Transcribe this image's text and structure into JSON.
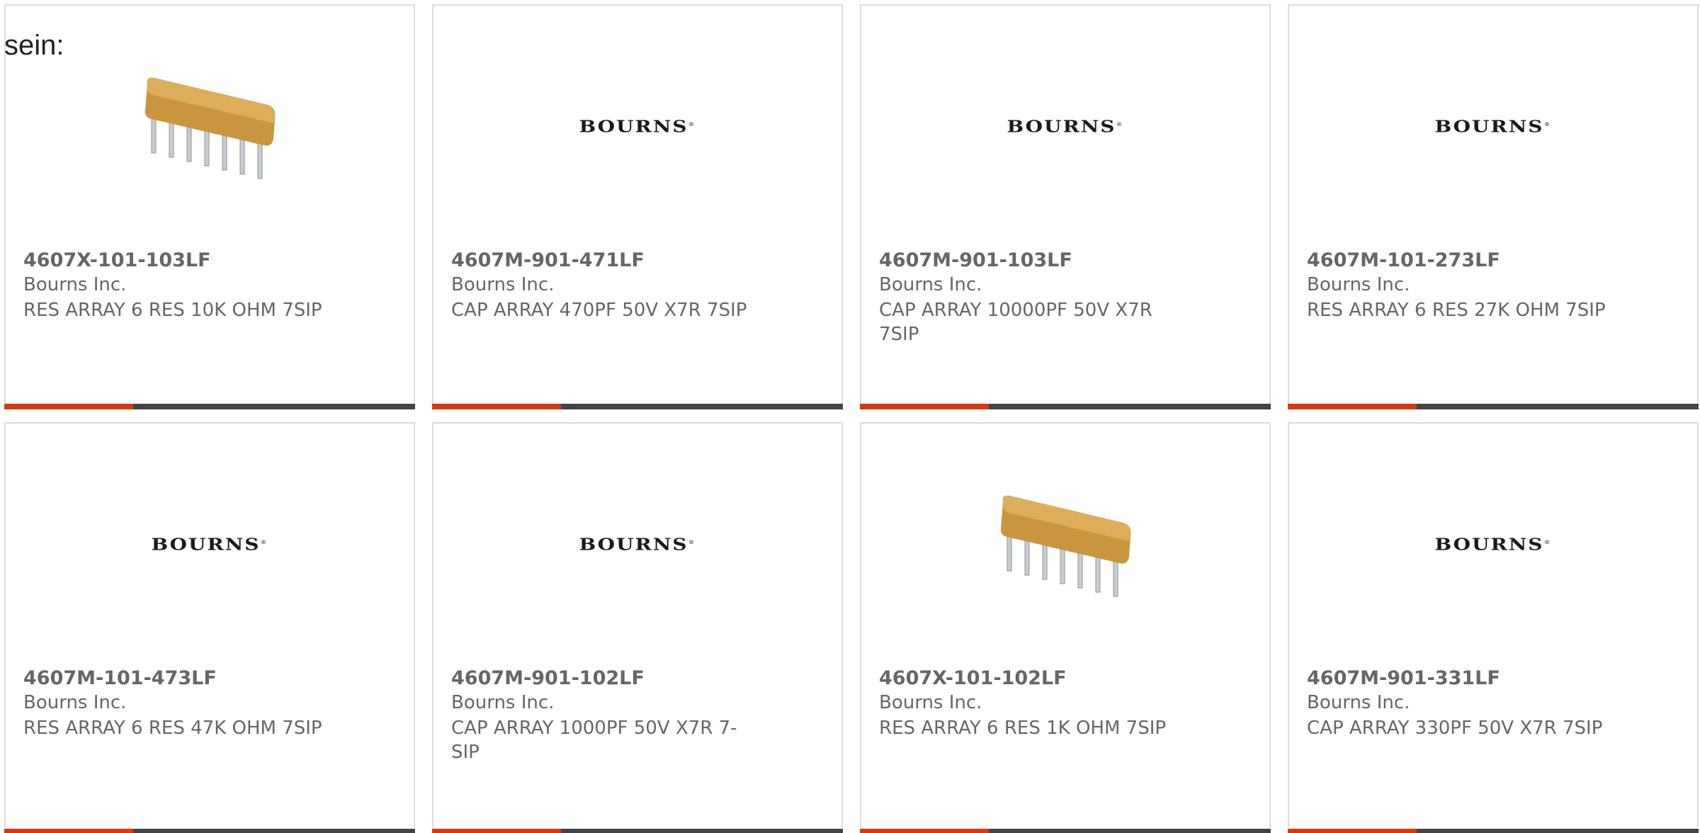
{
  "intro_text": "sein:",
  "products": [
    {
      "part": "4607X-101-103LF",
      "manufacturer": "Bourns Inc.",
      "description": "RES ARRAY 6 RES 10K OHM 7SIP",
      "image": "resistor-array-photo"
    },
    {
      "part": "4607M-901-471LF",
      "manufacturer": "Bourns Inc.",
      "description": "CAP ARRAY 470PF 50V X7R 7SIP",
      "image": "bourns-logo",
      "logo_text": "BOURNS"
    },
    {
      "part": "4607M-901-103LF",
      "manufacturer": "Bourns Inc.",
      "description": "CAP ARRAY 10000PF 50V X7R 7SIP",
      "image": "bourns-logo",
      "logo_text": "BOURNS"
    },
    {
      "part": "4607M-101-273LF",
      "manufacturer": "Bourns Inc.",
      "description": "RES ARRAY 6 RES 27K OHM 7SIP",
      "image": "bourns-logo",
      "logo_text": "BOURNS"
    },
    {
      "part": "4607M-101-473LF",
      "manufacturer": "Bourns Inc.",
      "description": "RES ARRAY 6 RES 47K OHM 7SIP",
      "image": "bourns-logo",
      "logo_text": "BOURNS"
    },
    {
      "part": "4607M-901-102LF",
      "manufacturer": "Bourns Inc.",
      "description": "CAP ARRAY 1000PF 50V X7R 7-SIP",
      "image": "bourns-logo",
      "logo_text": "BOURNS"
    },
    {
      "part": "4607X-101-102LF",
      "manufacturer": "Bourns Inc.",
      "description": "RES ARRAY 6 RES 1K OHM 7SIP",
      "image": "resistor-array-photo"
    },
    {
      "part": "4607M-901-331LF",
      "manufacturer": "Bourns Inc.",
      "description": "CAP ARRAY 330PF 50V X7R 7SIP",
      "image": "bourns-logo",
      "logo_text": "BOURNS"
    }
  ],
  "colors": {
    "accent": "#d9380f",
    "bar": "#444444",
    "text": "#666666",
    "border": "#dddddd"
  }
}
